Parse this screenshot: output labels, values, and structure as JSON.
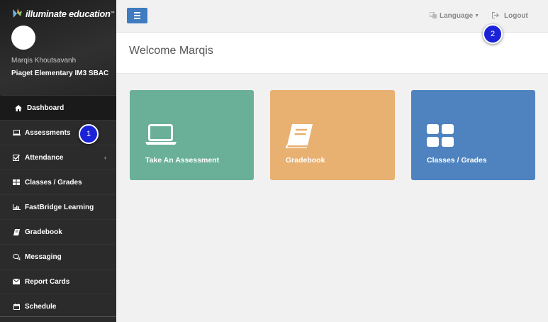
{
  "brand": {
    "name": "illuminate education",
    "tm": "™"
  },
  "user": {
    "name": "Marqis Khoutsavanh",
    "school": "Piaget Elementary IM3 SBAC"
  },
  "sidebar": {
    "items": [
      {
        "label": "Dashboard",
        "icon": "home-icon"
      },
      {
        "label": "Assessments",
        "icon": "laptop-icon"
      },
      {
        "label": "Attendance",
        "icon": "check-square-icon"
      },
      {
        "label": "Classes / Grades",
        "icon": "grid-icon"
      },
      {
        "label": "FastBridge Learning",
        "icon": "bar-chart-icon"
      },
      {
        "label": "Gradebook",
        "icon": "book-icon"
      },
      {
        "label": "Messaging",
        "icon": "comments-icon"
      },
      {
        "label": "Report Cards",
        "icon": "envelope-icon"
      },
      {
        "label": "Schedule",
        "icon": "calendar-icon"
      }
    ]
  },
  "topbar": {
    "language_label": "Language",
    "logout_label": "Logout"
  },
  "welcome": {
    "title": "Welcome Marqis"
  },
  "cards": {
    "assessment": {
      "label": "Take An Assessment",
      "color": "#6ab098"
    },
    "gradebook": {
      "label": "Gradebook",
      "color": "#e8b071"
    },
    "classes": {
      "label": "Classes / Grades",
      "color": "#4e83c0"
    }
  },
  "badges": {
    "one": "1",
    "two": "2"
  },
  "colors": {
    "accent": "#3e7bbf",
    "badge": "#1a23d8",
    "sidebar": "#2b2b2b"
  }
}
